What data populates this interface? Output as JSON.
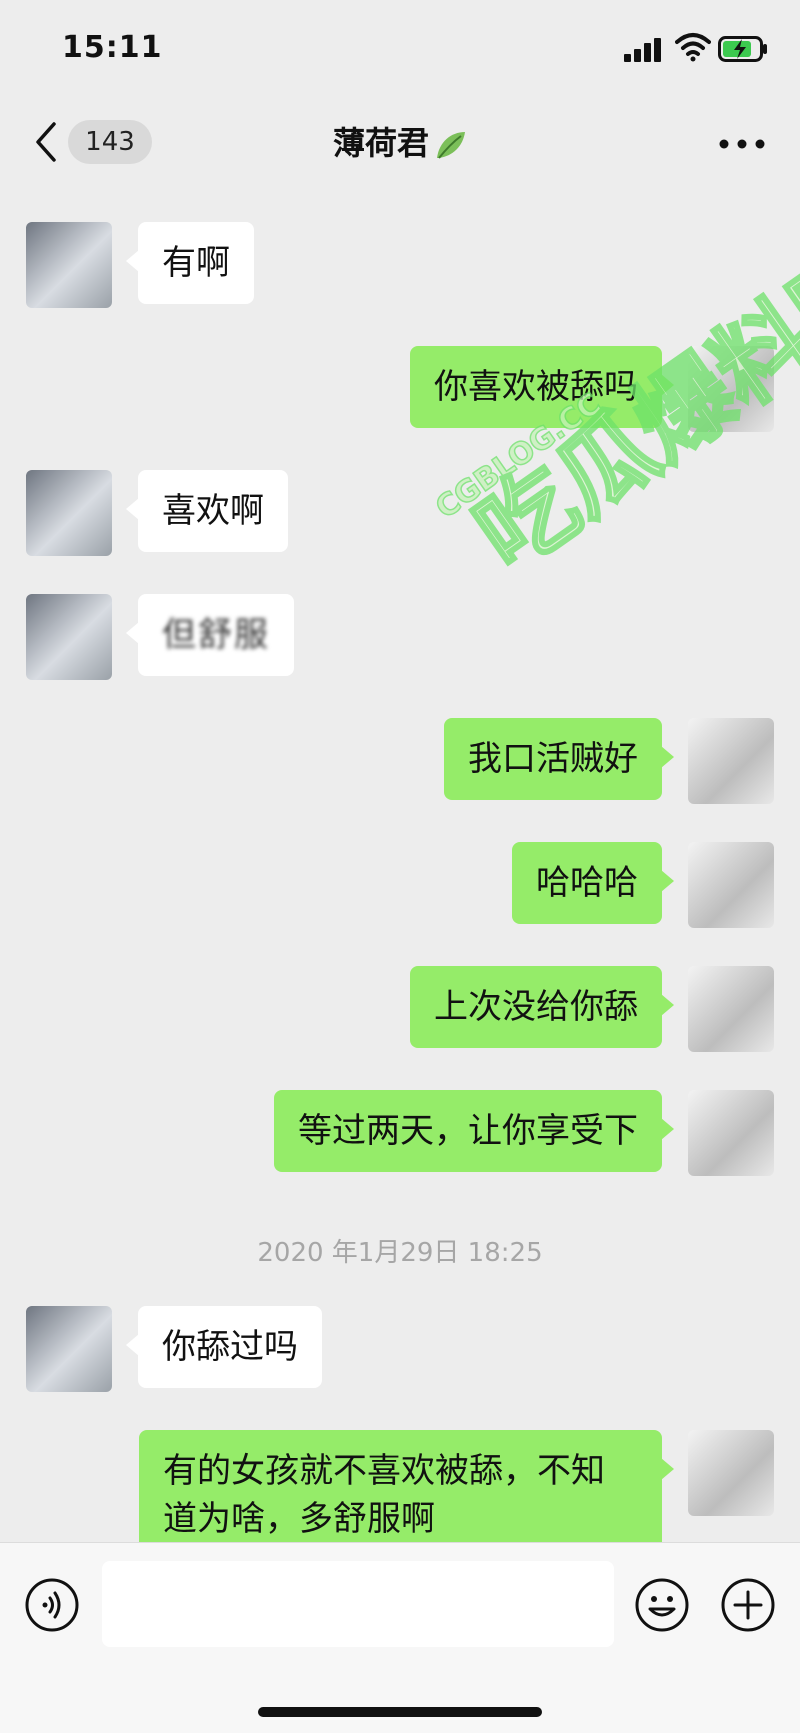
{
  "status_bar": {
    "time": "15:11",
    "icons": [
      "signal-icon",
      "wifi-icon",
      "battery-charging-icon"
    ]
  },
  "nav": {
    "back_icon": "chevron-left-icon",
    "unread_count": "143",
    "title": "薄荷君",
    "title_emoji": "leaf-icon",
    "more_icon": "more-dots-icon"
  },
  "messages": [
    {
      "side": "in",
      "text": "有啊"
    },
    {
      "side": "out",
      "text": "你喜欢被舔吗"
    },
    {
      "side": "in",
      "text": "喜欢啊"
    },
    {
      "side": "in",
      "text": "但舒服",
      "obscured": true
    },
    {
      "side": "out",
      "text": "我口活贼好"
    },
    {
      "side": "out",
      "text": "哈哈哈"
    },
    {
      "side": "out",
      "text": "上次没给你舔"
    },
    {
      "side": "out",
      "text": "等过两天，让你享受下"
    },
    {
      "side": "in",
      "text": "你舔过吗"
    },
    {
      "side": "out",
      "text": "有的女孩就不喜欢被舔，不知道为啥，多舒服啊"
    }
  ],
  "timestamp": "2020 年1月29日 18:25",
  "watermark": {
    "site": "CGBLOG.CC",
    "text": "吃瓜爆料网"
  },
  "input_bar": {
    "voice_icon": "voice-icon",
    "input_value": "",
    "emoji_icon": "emoji-icon",
    "plus_icon": "plus-circle-icon"
  },
  "colors": {
    "background": "#ededed",
    "incoming_bubble": "#ffffff",
    "outgoing_bubble": "#95ec69",
    "timestamp": "#a6a6a6",
    "watermark_green": "#6ee26a"
  }
}
